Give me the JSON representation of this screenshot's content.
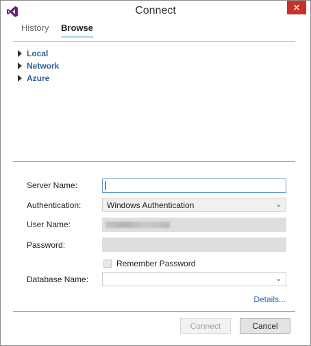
{
  "window": {
    "title": "Connect",
    "close_symbol": "✕",
    "app_icon": "visual-studio-icon",
    "accent_color": "#68217a",
    "close_color": "#c7312a"
  },
  "tabs": [
    {
      "label": "History",
      "active": false
    },
    {
      "label": "Browse",
      "active": true
    }
  ],
  "tree": {
    "items": [
      {
        "label": "Local",
        "icon": "expand-arrow-icon"
      },
      {
        "label": "Network",
        "icon": "expand-arrow-icon"
      },
      {
        "label": "Azure",
        "icon": "expand-arrow-icon"
      }
    ]
  },
  "form": {
    "server_name": {
      "label": "Server Name:",
      "value": ""
    },
    "authentication": {
      "label": "Authentication:",
      "value": "Windows Authentication"
    },
    "user_name": {
      "label": "User Name:"
    },
    "password": {
      "label": "Password:",
      "value": ""
    },
    "remember_password": {
      "label": "Remember Password",
      "checked": false
    },
    "database_name": {
      "label": "Database Name:",
      "value": ""
    }
  },
  "details_link": "Details...",
  "buttons": {
    "connect": "Connect",
    "cancel": "Cancel"
  }
}
